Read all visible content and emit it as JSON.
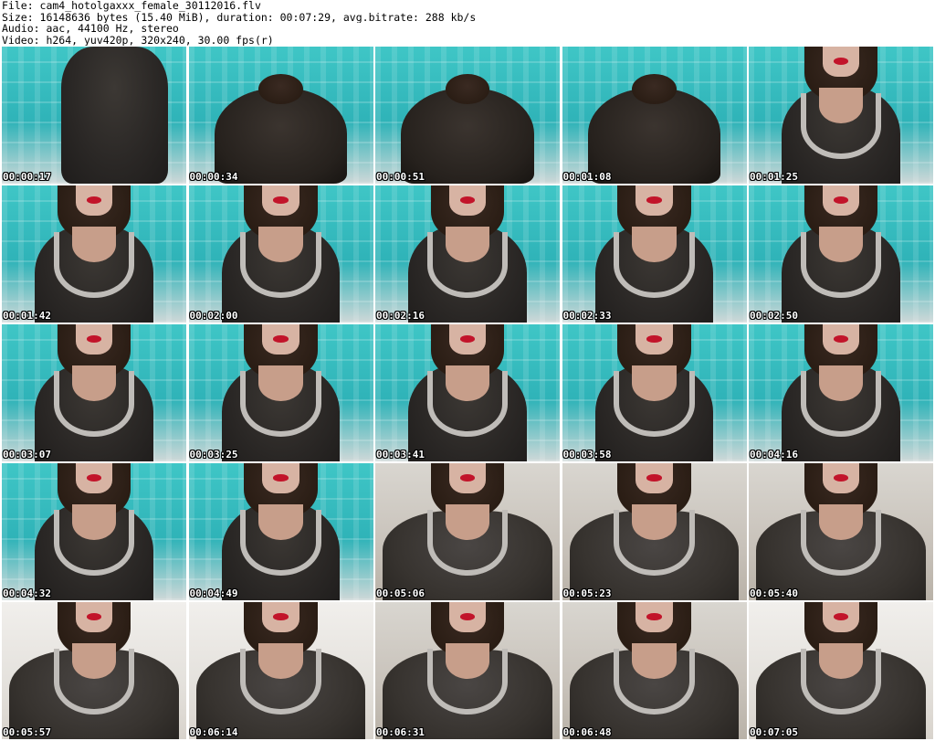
{
  "header": {
    "file_line": "File: cam4_hotolgaxxx_female_30112016.flv",
    "size_line": "Size: 16148636 bytes (15.40 MiB), duration: 00:07:29, avg.bitrate: 288 kb/s",
    "audio_line": "Audio: aac, 44100 Hz, stereo",
    "video_line": "Video: h264, yuv420p, 320x240, 30.00 fps(r)"
  },
  "thumbnails": [
    {
      "timestamp": "00:00:17",
      "scene": "curtain-standing"
    },
    {
      "timestamp": "00:00:34",
      "scene": "curtain-bending"
    },
    {
      "timestamp": "00:00:51",
      "scene": "curtain-bending"
    },
    {
      "timestamp": "00:01:08",
      "scene": "curtain-bending"
    },
    {
      "timestamp": "00:01:25",
      "scene": "curtain-closeup"
    },
    {
      "timestamp": "00:01:42",
      "scene": "curtain-closeup"
    },
    {
      "timestamp": "00:02:00",
      "scene": "curtain-closeup"
    },
    {
      "timestamp": "00:02:16",
      "scene": "curtain-closeup"
    },
    {
      "timestamp": "00:02:33",
      "scene": "curtain-closeup"
    },
    {
      "timestamp": "00:02:50",
      "scene": "curtain-closeup"
    },
    {
      "timestamp": "00:03:07",
      "scene": "curtain-closeup"
    },
    {
      "timestamp": "00:03:25",
      "scene": "curtain-closeup"
    },
    {
      "timestamp": "00:03:41",
      "scene": "curtain-closeup"
    },
    {
      "timestamp": "00:03:58",
      "scene": "curtain-closeup"
    },
    {
      "timestamp": "00:04:16",
      "scene": "curtain-closeup"
    },
    {
      "timestamp": "00:04:32",
      "scene": "curtain-closeup"
    },
    {
      "timestamp": "00:04:49",
      "scene": "curtain-closeup"
    },
    {
      "timestamp": "00:05:06",
      "scene": "room-closeup"
    },
    {
      "timestamp": "00:05:23",
      "scene": "room-closeup"
    },
    {
      "timestamp": "00:05:40",
      "scene": "room-closeup"
    },
    {
      "timestamp": "00:05:57",
      "scene": "bright-closeup"
    },
    {
      "timestamp": "00:06:14",
      "scene": "bright-closeup"
    },
    {
      "timestamp": "00:06:31",
      "scene": "room-closeup"
    },
    {
      "timestamp": "00:06:48",
      "scene": "room-closeup"
    },
    {
      "timestamp": "00:07:05",
      "scene": "bright-closeup"
    }
  ],
  "colors": {
    "curtain": "#3fc6c6",
    "garment": "#2b2826",
    "lips": "#c2142a",
    "timestamp_text": "#ffffff"
  }
}
